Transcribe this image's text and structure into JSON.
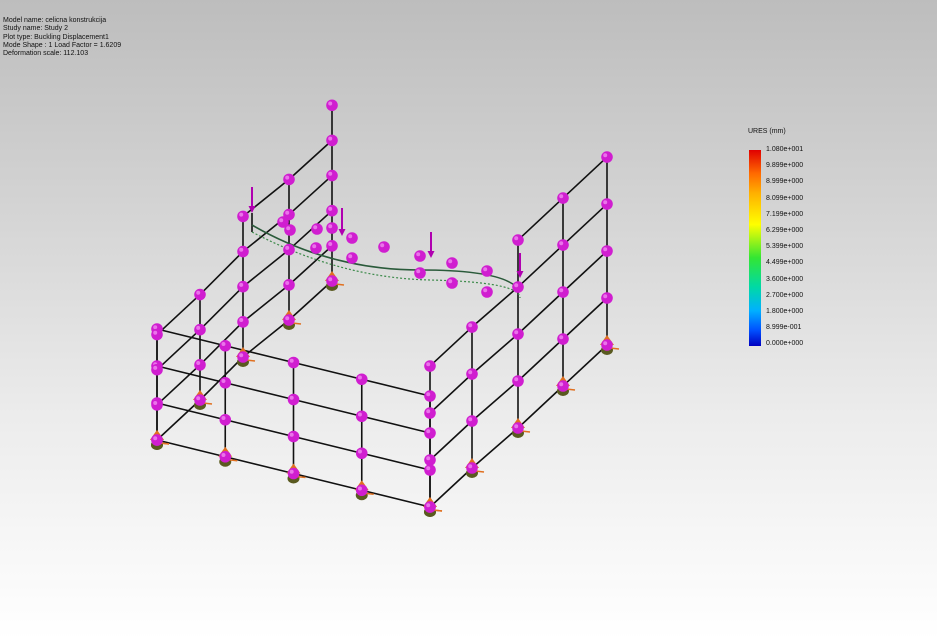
{
  "info": {
    "model_name": "Model name: celicna konstrukcija",
    "study_name": "Study name: Study 2",
    "plot_type": "Plot type: Buckling Displacement1",
    "mode_shape": "Mode Shape : 1  Load Factor = 1.6209",
    "deformation_scale": "Deformation scale: 112.103"
  },
  "legend": {
    "title": "URES (mm)",
    "values": [
      "1.080e+001",
      "9.899e+000",
      "8.999e+000",
      "8.099e+000",
      "7.199e+000",
      "6.299e+000",
      "5.399e+000",
      "4.499e+000",
      "3.600e+000",
      "2.700e+000",
      "1.800e+000",
      "8.999e-001",
      "0.000e+000"
    ]
  },
  "colors": {
    "node": "#d01ed0",
    "beam": "#111111",
    "fixture": "#e07020",
    "fixture_base": "#5a5a20",
    "load_arrow": "#b000b0"
  }
}
